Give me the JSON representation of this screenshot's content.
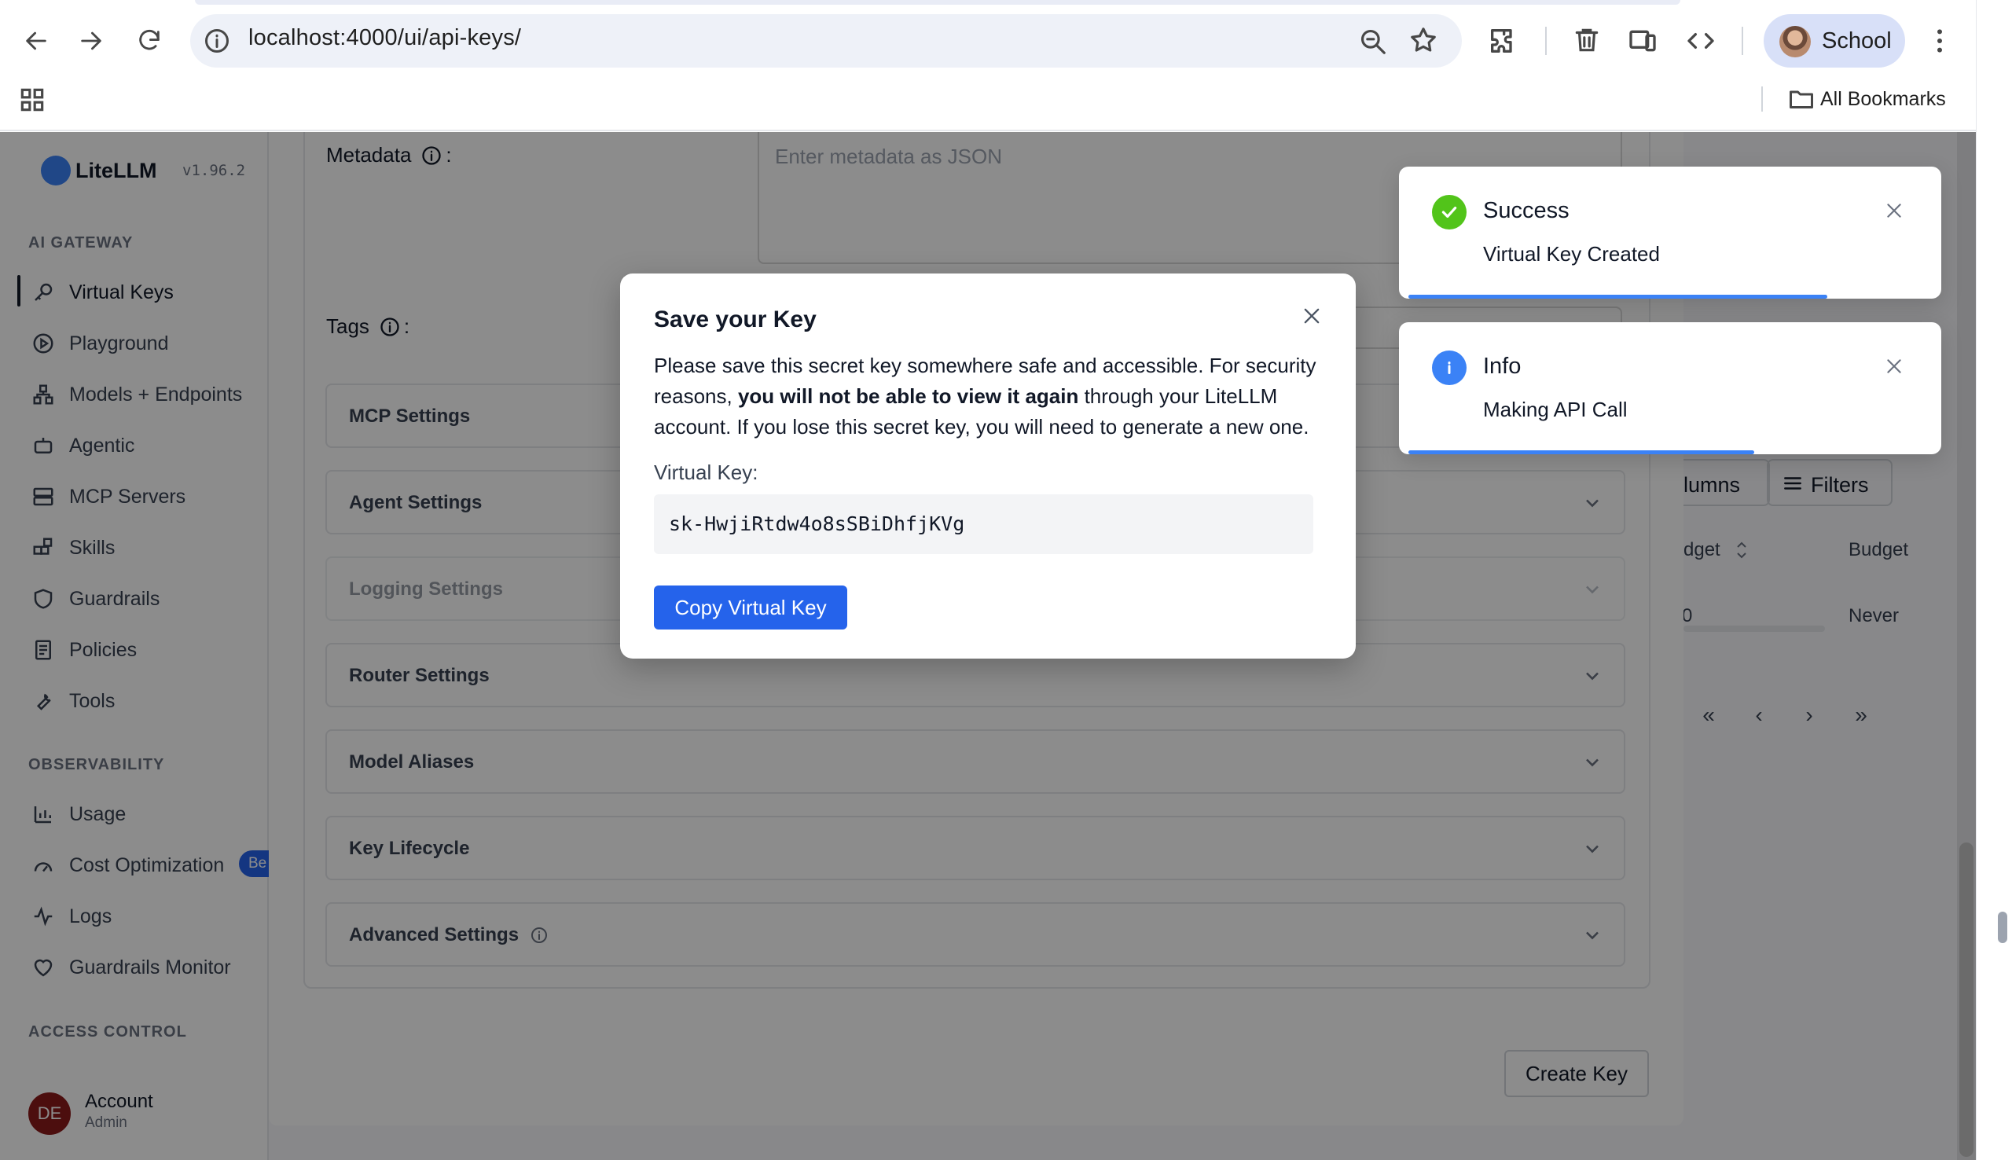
{
  "browser": {
    "url": "localhost:4000/ui/api-keys/",
    "profile_name": "School",
    "bookmarks_label": "All Bookmarks"
  },
  "sidebar": {
    "logo_text": "LiteLLM",
    "version": "v1.96.2",
    "sections": [
      {
        "title": "AI GATEWAY",
        "items": [
          "Virtual Keys",
          "Playground",
          "Models + Endpoints",
          "Agentic",
          "MCP Servers",
          "Skills",
          "Guardrails",
          "Policies",
          "Tools"
        ]
      },
      {
        "title": "OBSERVABILITY",
        "items": [
          "Usage",
          "Cost Optimization",
          "Logs",
          "Guardrails Monitor"
        ]
      },
      {
        "title": "ACCESS CONTROL",
        "items": []
      }
    ],
    "beta_badge": "Be",
    "account": {
      "initials": "DE",
      "name": "Account",
      "role": "Admin"
    }
  },
  "background_table": {
    "columns_btn": "lumns",
    "filters_btn": "Filters",
    "col_budget_partial": "dget",
    "col_budget": "Budget",
    "cell_zero_partial": "0",
    "cell_never": "Never",
    "pager": [
      "«",
      "‹",
      "›",
      "»"
    ]
  },
  "form": {
    "metadata_label": "Metadata",
    "metadata_placeholder": "Enter metadata as JSON",
    "tags_label": "Tags",
    "label_suffix": ":",
    "sections": [
      "MCP Settings",
      "Agent Settings",
      "Logging Settings",
      "Router Settings",
      "Model Aliases",
      "Key Lifecycle",
      "Advanced Settings"
    ],
    "create_button": "Create Key"
  },
  "modal": {
    "title": "Save your Key",
    "body_part1": "Please save this secret key somewhere safe and accessible. For security reasons, ",
    "body_bold": "you will not be able to view it again",
    "body_part2": " through your LiteLLM account. If you lose this secret key, you will need to generate a new one.",
    "key_label": "Virtual Key:",
    "key_value": "sk-HwjiRtdw4o8sSBiDhfjKVg",
    "copy_button": "Copy Virtual Key"
  },
  "toasts": [
    {
      "type": "success",
      "title": "Success",
      "message": "Virtual Key Created",
      "progress": 0.8,
      "color": "#52c41a"
    },
    {
      "type": "info",
      "title": "Info",
      "message": "Making API Call",
      "progress": 0.66,
      "color": "#3b82f6"
    }
  ],
  "colors": {
    "primary": "#2563eb",
    "success": "#52c41a",
    "info": "#3b82f6"
  }
}
